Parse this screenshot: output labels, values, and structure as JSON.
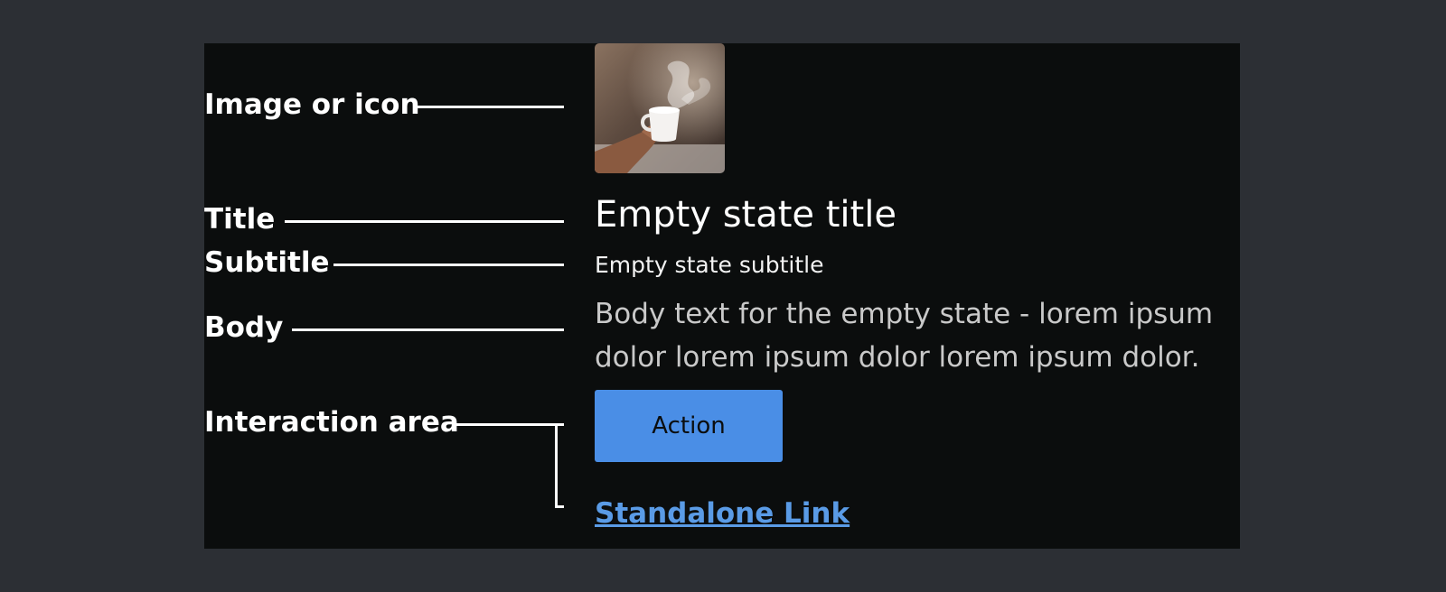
{
  "annotations": {
    "image": "Image or icon",
    "title": "Title",
    "subtitle": "Subtitle",
    "body": "Body",
    "interaction": "Interaction area"
  },
  "empty_state": {
    "image_alt": "Hand holding a steaming coffee cup",
    "title": "Empty state title",
    "subtitle": "Empty state subtitle",
    "body": "Body text for the empty state - lorem ipsum dolor lorem ipsum dolor lorem ipsum dolor.",
    "action_label": "Action",
    "link_label": "Standalone Link"
  },
  "colors": {
    "page_background": "#2c2f34",
    "canvas_background": "#0b0d0d",
    "button": "#4a8ee6",
    "link": "#5a9be6"
  }
}
